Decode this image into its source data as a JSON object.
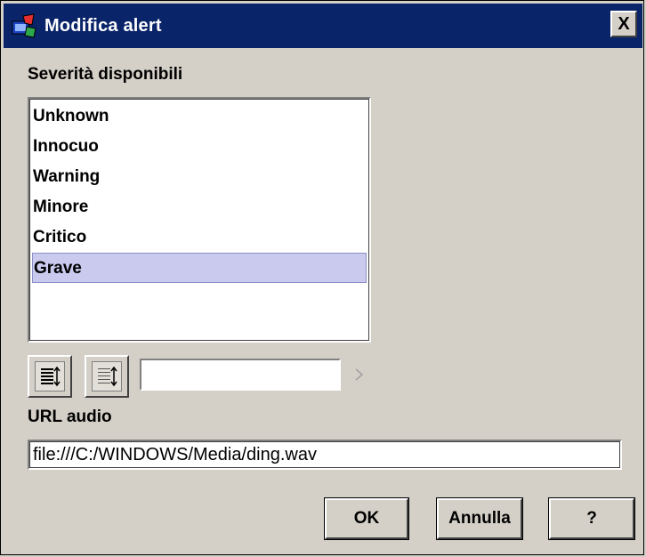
{
  "window": {
    "title": "Modifica alert",
    "close_glyph": "X"
  },
  "severity": {
    "label": "Severità disponibili",
    "items": [
      "Unknown",
      "Innocuo",
      "Warning",
      "Minore",
      "Critico",
      "Grave"
    ],
    "selected": "Grave"
  },
  "toolbar": {
    "move_up_icon": "list-sort-icon",
    "move_down_icon": "list-sort-icon",
    "value_input": ""
  },
  "audio": {
    "label": "URL audio",
    "url": "file:///C:/WINDOWS/Media/ding.wav"
  },
  "buttons": {
    "ok": "OK",
    "cancel": "Annulla",
    "help": "?"
  },
  "colors": {
    "titlebar": "#0a246a",
    "selection": "#c9caee",
    "dialog": "#d4d0c8"
  }
}
